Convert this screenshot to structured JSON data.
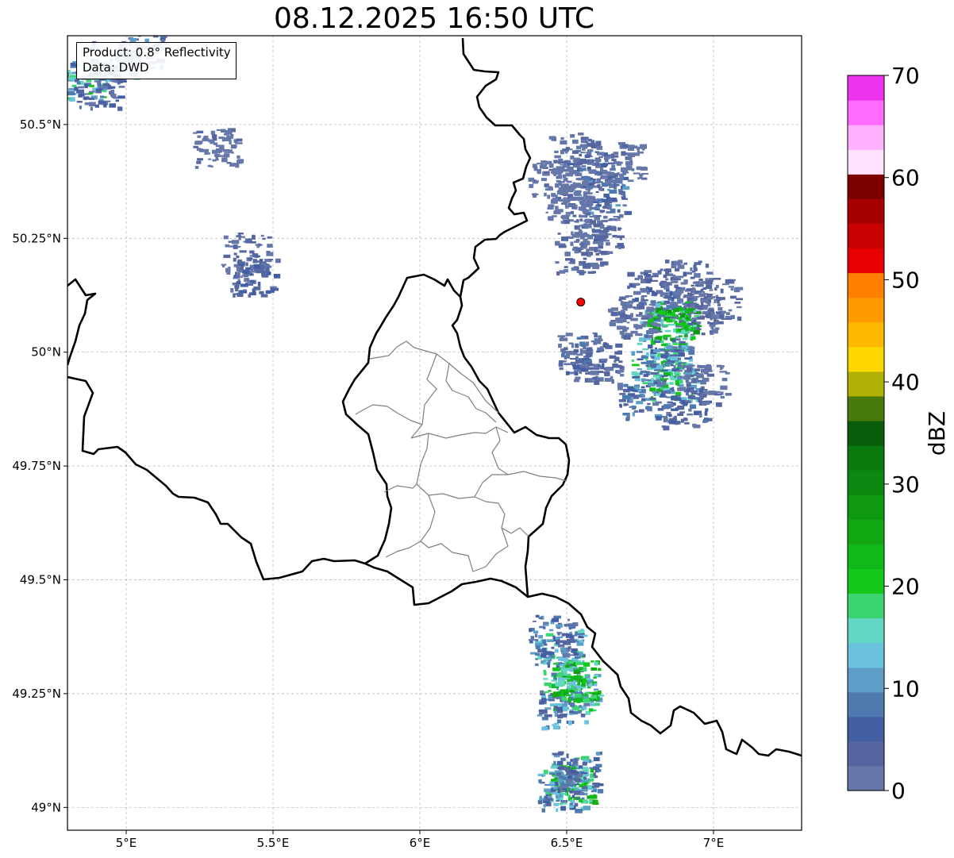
{
  "title": "08.12.2025 16:50 UTC",
  "info": {
    "product": "Product: 0.8° Reflectivity",
    "data": "Data: DWD"
  },
  "map": {
    "lon_range": [
      4.8,
      7.3
    ],
    "lat_range": [
      48.95,
      50.695
    ],
    "lon_ticks": [
      5.0,
      5.5,
      6.0,
      6.5,
      7.0
    ],
    "lon_tick_labels": [
      "5°E",
      "5.5°E",
      "6°E",
      "6.5°E",
      "7°E"
    ],
    "lat_ticks": [
      50.5,
      50.25,
      50.0,
      49.75,
      49.5,
      49.25,
      49.0
    ],
    "lat_tick_labels": [
      "50.5°N",
      "50.25°N",
      "50°N",
      "49.75°N",
      "49.5°N",
      "49.25°N",
      "49°N"
    ],
    "grid": true,
    "radar_site": {
      "lon": 6.548,
      "lat": 50.11,
      "color": "#ff0000"
    }
  },
  "colorbar": {
    "label": "dBZ",
    "min": 0,
    "max": 70,
    "tick_values": [
      0,
      10,
      20,
      30,
      40,
      50,
      60,
      70
    ],
    "tick_labels": [
      "0",
      "10",
      "20",
      "30",
      "40",
      "50",
      "60",
      "70"
    ],
    "colors": [
      "#6677aa",
      "#5566a0",
      "#445ea4",
      "#4f7ab0",
      "#5c9ec8",
      "#6ac2dc",
      "#64d6c4",
      "#3dd474",
      "#14c81a",
      "#11b81a",
      "#12a814",
      "#0f9812",
      "#0b8810",
      "#0a7a0e",
      "#095e0b",
      "#487a0c",
      "#b0b005",
      "#ffd700",
      "#ffb800",
      "#ff9a00",
      "#ff8000",
      "#e60000",
      "#c80000",
      "#a80000",
      "#7d0000",
      "#ffe0ff",
      "#ffb0ff",
      "#ff6cff",
      "#ee33ee"
    ]
  },
  "echoes": [
    {
      "region": "north",
      "points": [
        [
          6.52,
          50.44,
          4
        ],
        [
          6.58,
          50.4,
          8
        ],
        [
          6.62,
          50.35,
          12
        ],
        [
          6.56,
          50.3,
          6
        ],
        [
          6.6,
          50.26,
          4
        ],
        [
          6.45,
          50.38,
          3
        ],
        [
          6.54,
          50.22,
          5
        ],
        [
          6.68,
          50.42,
          3
        ],
        [
          6.5,
          50.34,
          2
        ]
      ]
    },
    {
      "region": "east",
      "points": [
        [
          6.78,
          50.14,
          6
        ],
        [
          6.85,
          50.1,
          10
        ],
        [
          6.9,
          50.16,
          5
        ],
        [
          6.95,
          50.08,
          4
        ],
        [
          6.82,
          50.05,
          22
        ],
        [
          6.86,
          50.07,
          28
        ],
        [
          7.0,
          50.12,
          4
        ],
        [
          6.72,
          50.08,
          3
        ]
      ]
    },
    {
      "region": "southeast",
      "points": [
        [
          6.8,
          49.96,
          20
        ],
        [
          6.86,
          49.94,
          25
        ],
        [
          6.75,
          49.9,
          12
        ],
        [
          6.9,
          49.88,
          8
        ],
        [
          6.84,
          49.99,
          15
        ],
        [
          6.6,
          49.98,
          5
        ],
        [
          6.55,
          50.0,
          8
        ],
        [
          6.96,
          49.93,
          4
        ]
      ]
    },
    {
      "region": "south1",
      "points": [
        [
          6.47,
          49.35,
          18
        ],
        [
          6.5,
          49.29,
          20
        ],
        [
          6.52,
          49.25,
          24
        ],
        [
          6.48,
          49.22,
          14
        ],
        [
          6.53,
          49.28,
          28
        ],
        [
          6.45,
          49.38,
          12
        ]
      ]
    },
    {
      "region": "south2",
      "points": [
        [
          6.5,
          49.07,
          20
        ],
        [
          6.52,
          49.05,
          25
        ],
        [
          6.48,
          49.04,
          15
        ],
        [
          6.53,
          49.08,
          12
        ]
      ]
    },
    {
      "region": "northwest",
      "points": [
        [
          4.85,
          50.6,
          20
        ],
        [
          4.95,
          50.64,
          15
        ],
        [
          5.05,
          50.67,
          12
        ],
        [
          4.9,
          50.58,
          8
        ],
        [
          5.4,
          50.22,
          4
        ],
        [
          5.43,
          50.17,
          6
        ],
        [
          5.3,
          50.45,
          3
        ]
      ]
    }
  ]
}
